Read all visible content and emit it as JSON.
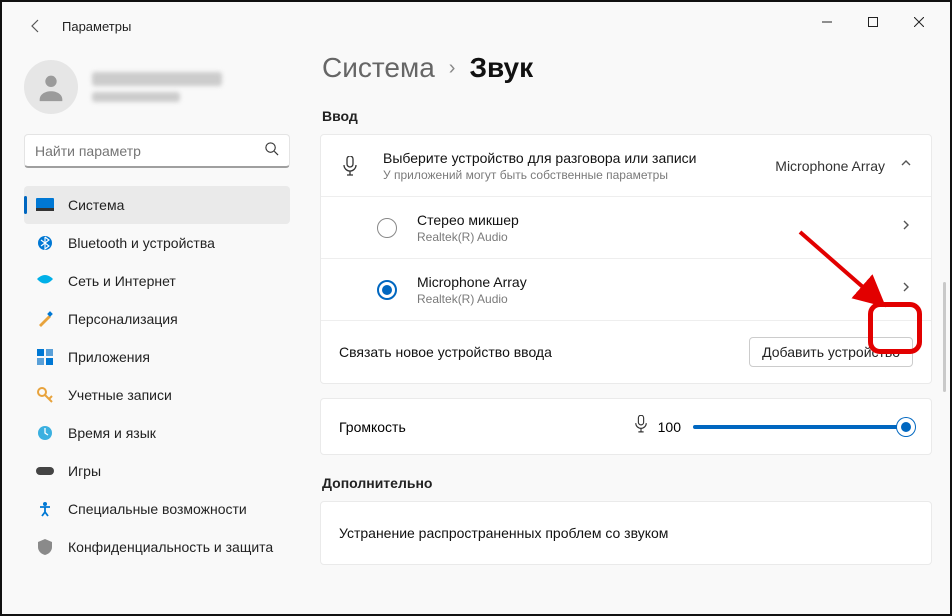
{
  "window": {
    "title": "Параметры"
  },
  "search": {
    "placeholder": "Найти параметр"
  },
  "nav": {
    "items": [
      {
        "label": "Система"
      },
      {
        "label": "Bluetooth и устройства"
      },
      {
        "label": "Сеть и Интернет"
      },
      {
        "label": "Персонализация"
      },
      {
        "label": "Приложения"
      },
      {
        "label": "Учетные записи"
      },
      {
        "label": "Время и язык"
      },
      {
        "label": "Игры"
      },
      {
        "label": "Специальные возможности"
      },
      {
        "label": "Конфиденциальность и защита"
      }
    ]
  },
  "breadcrumb": {
    "parent": "Система",
    "current": "Звук"
  },
  "input_section": {
    "label": "Ввод",
    "device_select": {
      "title": "Выберите устройство для разговора или записи",
      "subtitle": "У приложений могут быть собственные параметры",
      "value": "Microphone Array"
    },
    "devices": [
      {
        "name": "Стерео микшер",
        "driver": "Realtek(R) Audio",
        "checked": false
      },
      {
        "name": "Microphone Array",
        "driver": "Realtek(R) Audio",
        "checked": true
      }
    ],
    "pair": {
      "text": "Связать новое устройство ввода",
      "button": "Добавить устройство"
    }
  },
  "volume": {
    "label": "Громкость",
    "value": "100"
  },
  "additional": {
    "label": "Дополнительно",
    "troubleshoot": "Устранение распространенных проблем со звуком"
  }
}
